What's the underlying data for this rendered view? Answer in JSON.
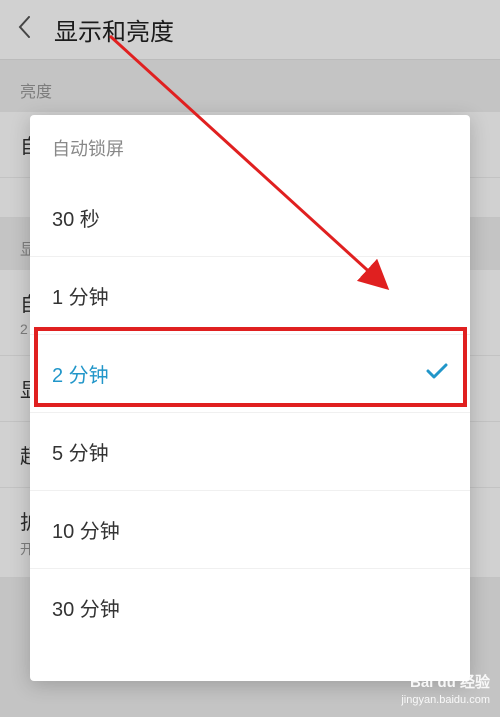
{
  "header": {
    "title": "显示和亮度"
  },
  "sections": {
    "brightness_label": "亮度",
    "auto_row": "自",
    "display_label": "显",
    "auto_lock_row": "自",
    "auto_lock_value": "2",
    "display_row": "显",
    "super_row": "超",
    "eye_mode": "护眼模式",
    "eye_mode_status": "开启"
  },
  "dialog": {
    "title": "自动锁屏",
    "options": [
      {
        "label": "30 秒",
        "selected": false
      },
      {
        "label": "1 分钟",
        "selected": false
      },
      {
        "label": "2 分钟",
        "selected": true
      },
      {
        "label": "5 分钟",
        "selected": false
      },
      {
        "label": "10 分钟",
        "selected": false
      },
      {
        "label": "30 分钟",
        "selected": false
      }
    ]
  },
  "watermark": {
    "brand": "Bai du 经验",
    "url": "jingyan.baidu.com"
  },
  "annotation": {
    "highlight_color": "#e02020",
    "arrow_color": "#e02020"
  }
}
